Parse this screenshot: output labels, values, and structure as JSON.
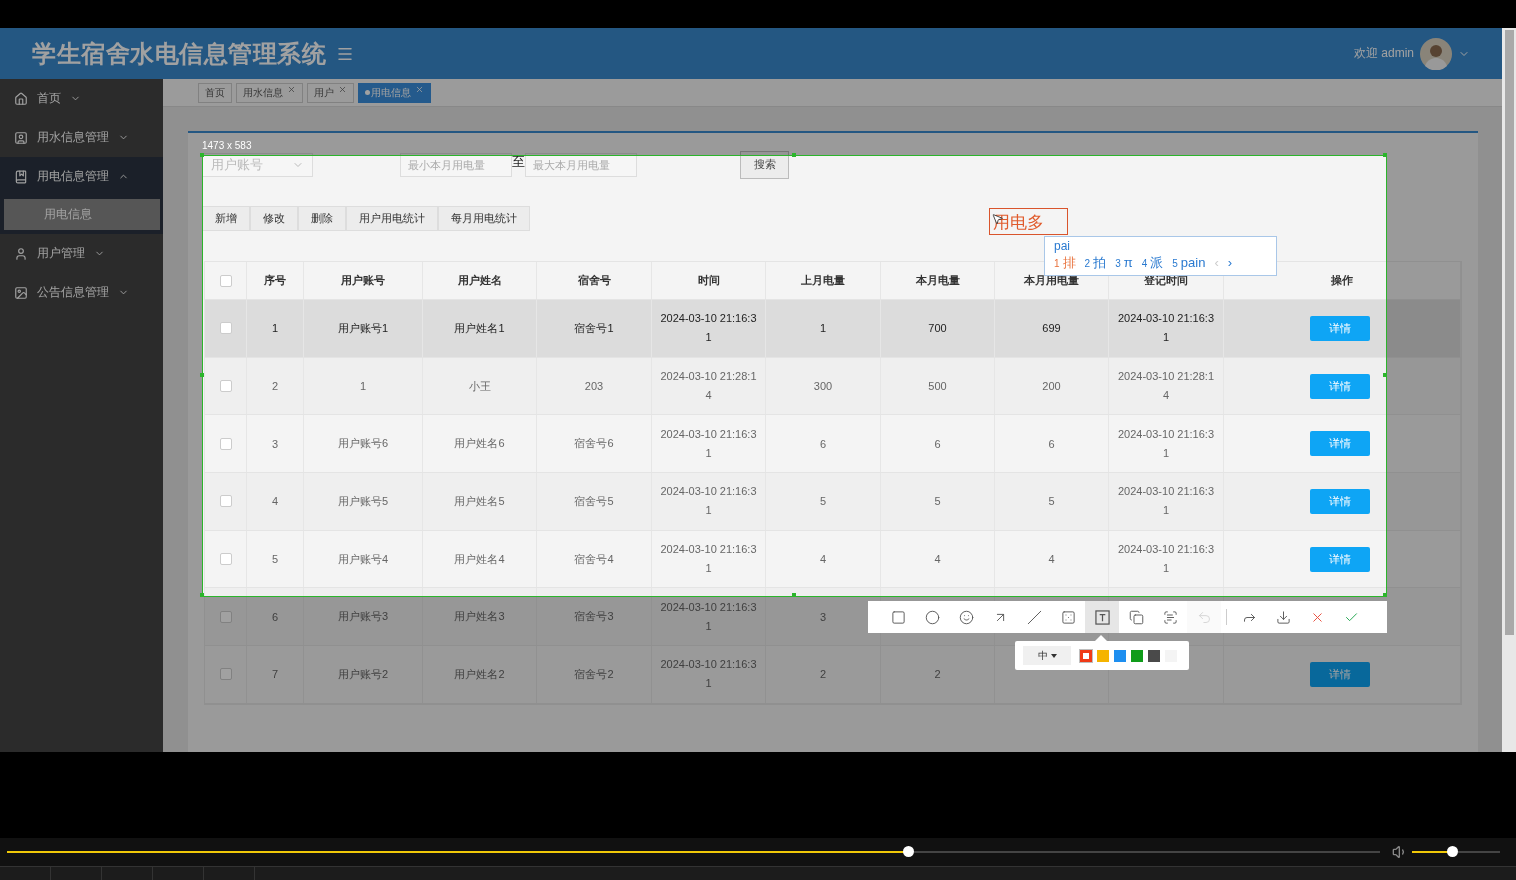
{
  "app": {
    "title": "学生宿舍水电信息管理系统",
    "greeting": "欢迎 admin"
  },
  "sidebar": {
    "items": [
      {
        "kind": "home",
        "label": "首页",
        "expanded": false
      },
      {
        "kind": "water",
        "label": "用水信息管理",
        "expanded": false
      },
      {
        "kind": "power",
        "label": "用电信息管理",
        "expanded": true,
        "children": [
          {
            "label": "用电信息",
            "selected": true
          }
        ]
      },
      {
        "kind": "user",
        "label": "用户管理",
        "expanded": false
      },
      {
        "kind": "notice",
        "label": "公告信息管理",
        "expanded": false
      }
    ]
  },
  "tabs": [
    {
      "label": "首页",
      "closable": false,
      "selected": false
    },
    {
      "label": "用水信息",
      "closable": true,
      "selected": false
    },
    {
      "label": "用户",
      "closable": true,
      "selected": false
    },
    {
      "label": "用电信息",
      "closable": true,
      "selected": true
    }
  ],
  "search": {
    "account_select": {
      "placeholder": "用户账号"
    },
    "min_field": {
      "placeholder": "最小本月用电量"
    },
    "range_separator": "至",
    "max_field": {
      "placeholder": "最大本月用电量"
    },
    "button": "搜索"
  },
  "actions": [
    "新增",
    "修改",
    "删除",
    "用户用电统计",
    "每月用电统计"
  ],
  "table": {
    "all_checked": false,
    "columns": [
      "序号",
      "用户账号",
      "用户姓名",
      "宿舍号",
      "时间",
      "上月电量",
      "本月电量",
      "本月用电量",
      "登记时间",
      "操作"
    ],
    "rows": [
      {
        "selected": true,
        "checked": false,
        "no": "1",
        "account": "用户账号1",
        "name": "用户姓名1",
        "room": "宿舍号1",
        "time": "2024-03-10 21:16:31",
        "last": "1",
        "current": "700",
        "usage": "699",
        "registered": "2024-03-10 21:16:31",
        "action": "详情"
      },
      {
        "selected": false,
        "checked": false,
        "no": "2",
        "account": "1",
        "name": "小王",
        "room": "203",
        "time": "2024-03-10 21:28:14",
        "last": "300",
        "current": "500",
        "usage": "200",
        "registered": "2024-03-10 21:28:14",
        "action": "详情"
      },
      {
        "selected": false,
        "checked": false,
        "no": "3",
        "account": "用户账号6",
        "name": "用户姓名6",
        "room": "宿舍号6",
        "time": "2024-03-10 21:16:31",
        "last": "6",
        "current": "6",
        "usage": "6",
        "registered": "2024-03-10 21:16:31",
        "action": "详情"
      },
      {
        "selected": false,
        "checked": false,
        "no": "4",
        "account": "用户账号5",
        "name": "用户姓名5",
        "room": "宿舍号5",
        "time": "2024-03-10 21:16:31",
        "last": "5",
        "current": "5",
        "usage": "5",
        "registered": "2024-03-10 21:16:31",
        "action": "详情"
      },
      {
        "selected": false,
        "checked": false,
        "no": "5",
        "account": "用户账号4",
        "name": "用户姓名4",
        "room": "宿舍号4",
        "time": "2024-03-10 21:16:31",
        "last": "4",
        "current": "4",
        "usage": "4",
        "registered": "2024-03-10 21:16:31",
        "action": "详情"
      },
      {
        "selected": false,
        "checked": false,
        "no": "6",
        "account": "用户账号3",
        "name": "用户姓名3",
        "room": "宿舍号3",
        "time": "2024-03-10 21:16:31",
        "last": "3"
      },
      {
        "selected": false,
        "checked": false,
        "no": "7",
        "account": "用户账号2",
        "name": "用户姓名2",
        "room": "宿舍号2",
        "time": "2024-03-10 21:16:31",
        "last": "2",
        "current": "2",
        "action": "详情"
      }
    ]
  },
  "screenshot_tool": {
    "size_label": "1473 x 583",
    "text_annotation": "用电多",
    "tools": [
      {
        "kind": "rectangle",
        "selected": false,
        "disabled": false
      },
      {
        "kind": "ellipse",
        "selected": false,
        "disabled": false
      },
      {
        "kind": "emoji",
        "selected": false,
        "disabled": false
      },
      {
        "kind": "arrow",
        "selected": false,
        "disabled": false
      },
      {
        "kind": "line",
        "selected": false,
        "disabled": false
      },
      {
        "kind": "mosaic",
        "selected": false,
        "disabled": false
      },
      {
        "kind": "text",
        "selected": true,
        "disabled": false
      },
      {
        "kind": "pin",
        "selected": false,
        "disabled": false
      },
      {
        "kind": "ocr",
        "selected": false,
        "disabled": false
      },
      {
        "kind": "undo",
        "selected": false,
        "disabled": true
      },
      {
        "kind": "share",
        "selected": false,
        "disabled": false
      },
      {
        "kind": "save",
        "selected": false,
        "disabled": false
      },
      {
        "kind": "cancel",
        "selected": false,
        "disabled": false
      },
      {
        "kind": "confirm",
        "selected": false,
        "disabled": false
      }
    ],
    "pen_size": "中",
    "colors": [
      {
        "color": "#f03a17",
        "selected": true
      },
      {
        "color": "#f5b400",
        "selected": false
      },
      {
        "color": "#1e8ff0",
        "selected": false
      },
      {
        "color": "#109c1a",
        "selected": false
      },
      {
        "color": "#4a4a4a",
        "selected": false
      },
      {
        "color": "#f4f4f4",
        "selected": false
      }
    ]
  },
  "ime": {
    "input": "pai",
    "candidates": [
      {
        "index": "1",
        "text": "排",
        "selected": true
      },
      {
        "index": "2",
        "text": "拍",
        "selected": false
      },
      {
        "index": "3",
        "text": "π",
        "selected": false
      },
      {
        "index": "4",
        "text": "派",
        "selected": false
      },
      {
        "index": "5",
        "text": "pain",
        "selected": false
      }
    ],
    "prev": "‹",
    "next": "›"
  },
  "player": {
    "progress": {
      "level": 0.656
    },
    "volume": {
      "level": 0.45
    }
  }
}
